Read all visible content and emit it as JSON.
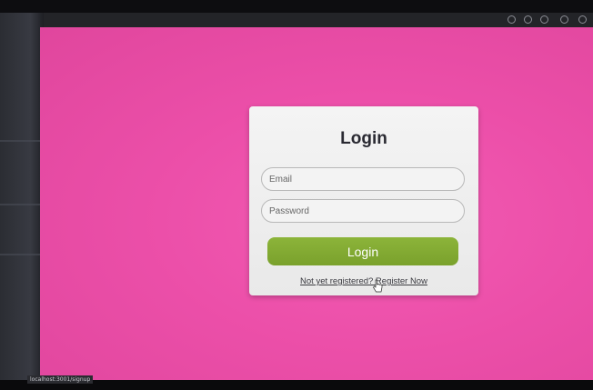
{
  "login": {
    "title": "Login",
    "email_placeholder": "Email",
    "password_placeholder": "Password",
    "submit_label": "Login",
    "register_link": "Not yet registered? Register Now"
  },
  "status": {
    "url": "localhost:3001/signup"
  },
  "colors": {
    "background": "#ec4fa9",
    "button": "#7fa82f",
    "card": "#efefef"
  }
}
